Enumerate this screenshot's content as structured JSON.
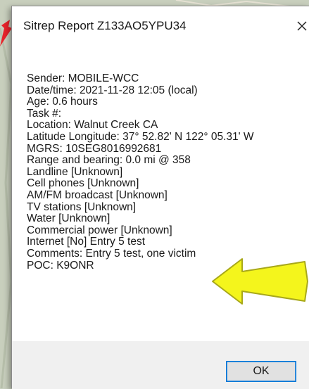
{
  "window": {
    "title": "Sitrep Report Z133AO5YPU34",
    "close_glyph": "×"
  },
  "report": {
    "lines": [
      "Sender: MOBILE-WCC",
      "Date/time: 2021-11-28 12:05  (local)",
      "Age: 0.6 hours",
      "Task #:",
      "Location: Walnut Creek CA",
      "Latitude Longitude: 37° 52.82' N 122° 05.31' W",
      "MGRS: 10SEG8016992681",
      "Range and bearing: 0.0 mi @ 358",
      "Landline [Unknown]",
      "Cell phones [Unknown]",
      "AM/FM broadcast [Unknown]",
      "TV stations [Unknown]",
      "Water [Unknown]",
      "Commercial power [Unknown]",
      "Internet [No] Entry 5 test",
      "Comments: Entry 5 test, one victim",
      "POC: K9ONR"
    ]
  },
  "buttons": {
    "ok_label": "OK"
  },
  "annotations": {
    "red_arrow_icon": "arrow-icon",
    "red_arrow_color": "#e8232a",
    "yellow_arrow_icon": "arrow-left-icon",
    "yellow_arrow_color": "#f4f51c"
  }
}
